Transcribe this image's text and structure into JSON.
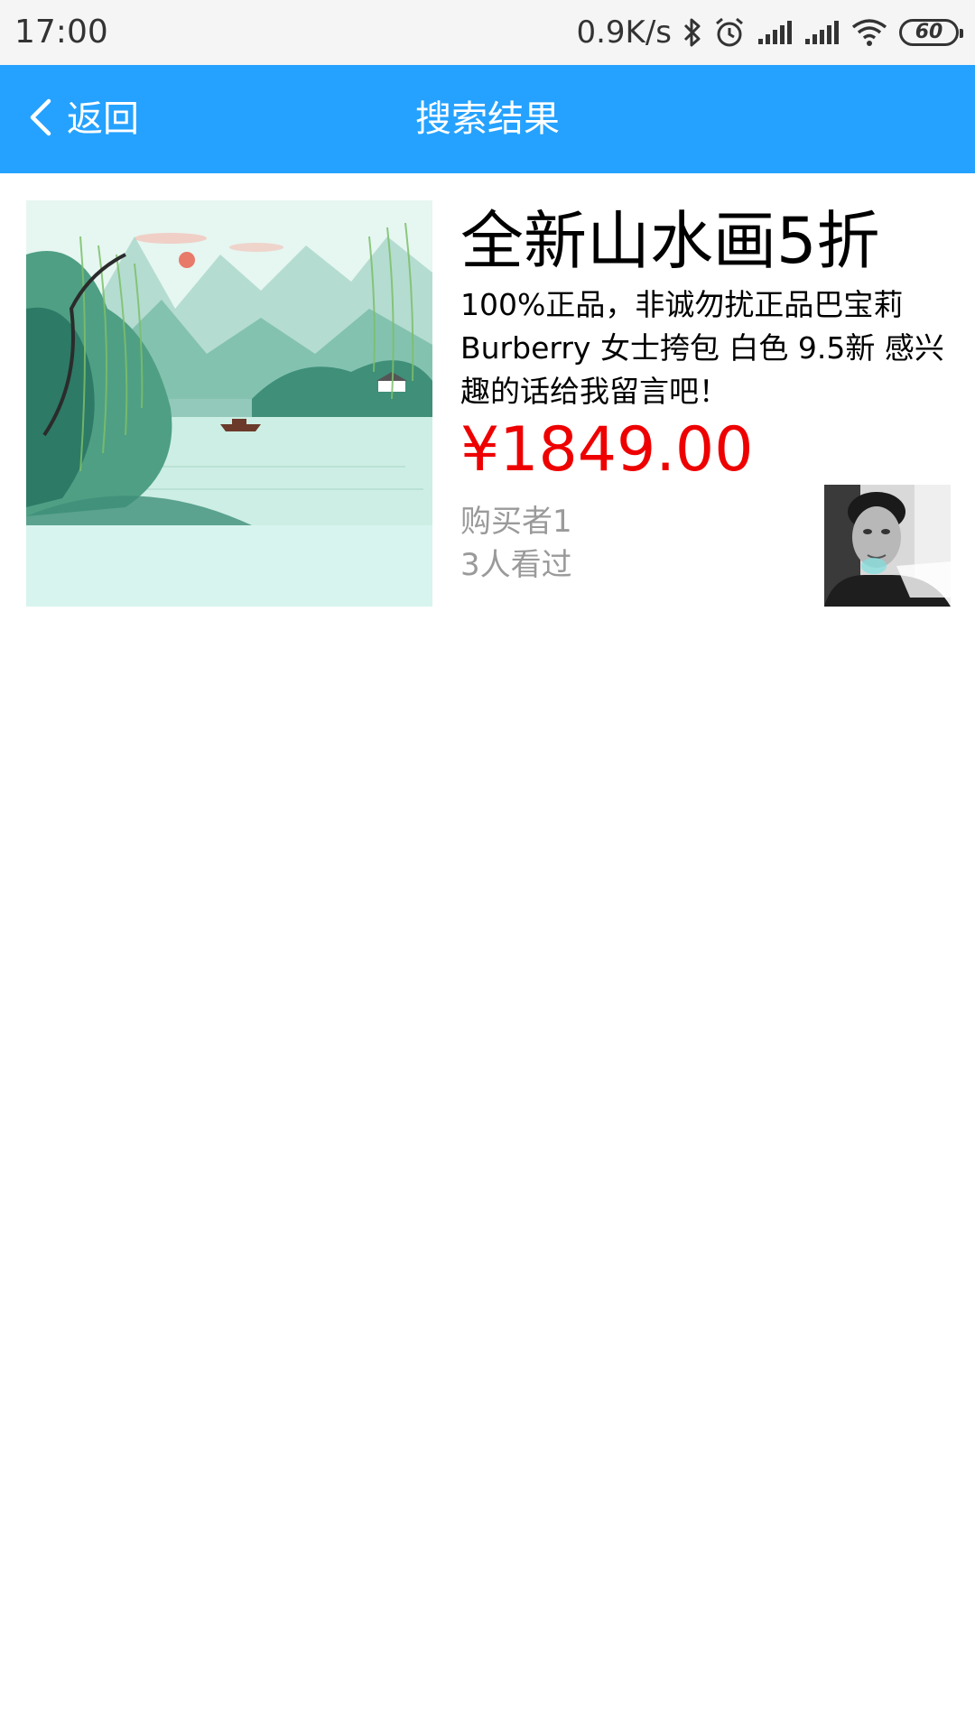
{
  "status_bar": {
    "time": "17:00",
    "net_speed": "0.9K/s",
    "battery_level": "60",
    "icons": [
      "bluetooth-icon",
      "alarm-icon",
      "signal-icon",
      "signal-icon",
      "wifi-icon",
      "battery-icon"
    ]
  },
  "nav": {
    "back_label": "返回",
    "title": "搜索结果",
    "color": "#25a2ff"
  },
  "results": [
    {
      "title": "全新山水画5折",
      "description": "100%正品，非诚勿扰正品巴宝莉Burberry 女士挎包 白色 9.5新 感兴趣的话给我留言吧！",
      "price": "¥1849.00",
      "buyer": "购买者1",
      "views": "3人看过",
      "price_color": "#ee0000"
    }
  ]
}
